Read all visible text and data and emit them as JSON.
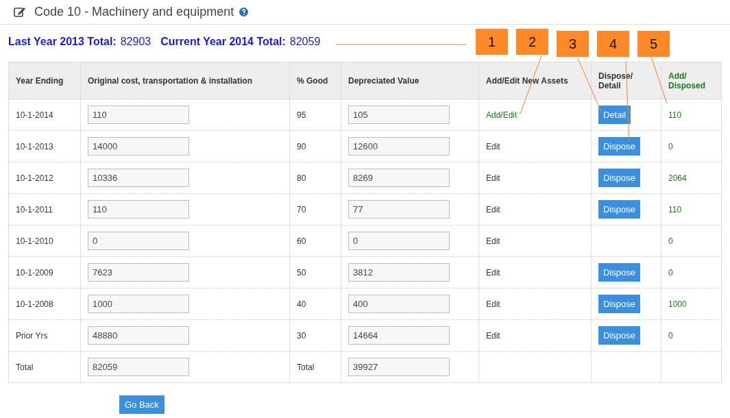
{
  "title": "Code 10 - Machinery and equipment",
  "totals": [
    {
      "label": "Last Year 2013 Total:",
      "value": "82903"
    },
    {
      "label": "Current Year 2014 Total:",
      "value": "82059"
    }
  ],
  "callouts": [
    "1",
    "2",
    "3",
    "4",
    "5"
  ],
  "table": {
    "columns": [
      "Year Ending",
      "Original cost, transportation & installation",
      "% Good",
      "Depreciated Value",
      "Add/Edit New Assets",
      "Dispose/ Detail",
      "Add/ Disposed"
    ],
    "rows": [
      {
        "year": "10-1-2014",
        "original": "110",
        "good": "95",
        "depreciated": "105",
        "link": {
          "label": "Add/Edit",
          "kind": "add"
        },
        "action": "Detail",
        "added": "110"
      },
      {
        "year": "10-1-2013",
        "original": "14000",
        "good": "90",
        "depreciated": "12600",
        "link": {
          "label": "Edit",
          "kind": "edit"
        },
        "action": "Dispose",
        "added": "0"
      },
      {
        "year": "10-1-2012",
        "original": "10336",
        "good": "80",
        "depreciated": "8269",
        "link": {
          "label": "Edit",
          "kind": "edit"
        },
        "action": "Dispose",
        "added": "2064"
      },
      {
        "year": "10-1-2011",
        "original": "110",
        "good": "70",
        "depreciated": "77",
        "link": {
          "label": "Edit",
          "kind": "edit"
        },
        "action": "Dispose",
        "added": "110"
      },
      {
        "year": "10-1-2010",
        "original": "0",
        "good": "60",
        "depreciated": "0",
        "link": {
          "label": "Edit",
          "kind": "edit"
        },
        "action": null,
        "added": "0"
      },
      {
        "year": "10-1-2009",
        "original": "7623",
        "good": "50",
        "depreciated": "3812",
        "link": {
          "label": "Edit",
          "kind": "edit"
        },
        "action": "Dispose",
        "added": "0"
      },
      {
        "year": "10-1-2008",
        "original": "1000",
        "good": "40",
        "depreciated": "400",
        "link": {
          "label": "Edit",
          "kind": "edit"
        },
        "action": "Dispose",
        "added": "1000"
      },
      {
        "year": "Prior Yrs",
        "original": "48880",
        "good": "30",
        "depreciated": "14664",
        "link": {
          "label": "Edit",
          "kind": "edit"
        },
        "action": "Dispose",
        "added": "0"
      }
    ],
    "total_row": {
      "label": "Total",
      "original": "82059",
      "good_label": "Total",
      "depreciated": "39927"
    }
  },
  "back_button": "Go Back"
}
